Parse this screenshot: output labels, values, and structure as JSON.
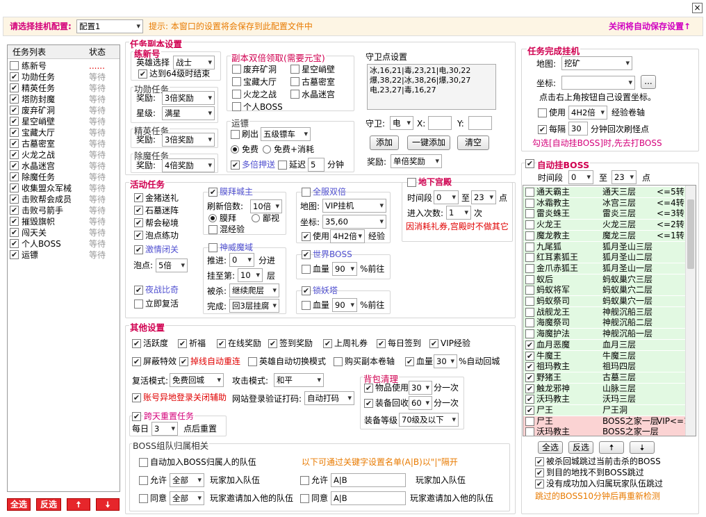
{
  "window": {
    "close": "×"
  },
  "header": {
    "select_label": "请选择挂机配置:",
    "config": "配置1",
    "hint": "提示: 本窗口的设置将会保存到此配置文件中",
    "close_hint": "关闭将自动保存设置↑"
  },
  "task_list": {
    "col1": "任务列表",
    "col2": "状态",
    "items": [
      {
        "name": "练新号",
        "checked": false,
        "status": "......"
      },
      {
        "name": "功勋任务",
        "checked": true,
        "status": "等待"
      },
      {
        "name": "精英任务",
        "checked": true,
        "status": "等待"
      },
      {
        "name": "塔防封魔",
        "checked": true,
        "status": "等待"
      },
      {
        "name": "废弃矿洞",
        "checked": true,
        "status": "等待"
      },
      {
        "name": "星空峭壁",
        "checked": true,
        "status": "等待"
      },
      {
        "name": "宝藏大厅",
        "checked": true,
        "status": "等待"
      },
      {
        "name": "古墓密室",
        "checked": true,
        "status": "等待"
      },
      {
        "name": "火龙之战",
        "checked": true,
        "status": "等待"
      },
      {
        "name": "水晶迷宫",
        "checked": true,
        "status": "等待"
      },
      {
        "name": "除魔任务",
        "checked": true,
        "status": "等待"
      },
      {
        "name": "收集盟众军械",
        "checked": true,
        "status": "等待"
      },
      {
        "name": "击败帮会成员",
        "checked": true,
        "status": "等待"
      },
      {
        "name": "击败弓箭手",
        "checked": true,
        "status": "等待"
      },
      {
        "name": "摧毁旗帜",
        "checked": true,
        "status": "等待"
      },
      {
        "name": "闯天关",
        "checked": true,
        "status": "等待"
      },
      {
        "name": "个人BOSS",
        "checked": true,
        "status": "等待"
      },
      {
        "name": "运镖",
        "checked": true,
        "status": "等待"
      }
    ],
    "buttons": {
      "all": "全选",
      "invert": "反选",
      "up": "🠅",
      "down": "🠇"
    }
  },
  "dungeon": {
    "title": "任务副本设置",
    "new": {
      "title": "练新号",
      "hero_label": "英雄选择",
      "hero": "战士",
      "stop_label": "达到64级时结束"
    },
    "merit": {
      "title": "功勋任务",
      "reward_label": "奖励:",
      "reward": "3倍奖励",
      "star_label": "星级:",
      "star": "满星"
    },
    "elite": {
      "title": "精英任务",
      "reward_label": "奖励:",
      "reward": "3倍奖励"
    },
    "demon": {
      "title": "除魔任务",
      "reward_label": "奖励:",
      "reward": "4倍奖励"
    },
    "double": {
      "title": "副本双倍领取(需要元宝)",
      "items": [
        "废弃矿洞",
        "星空峭壁",
        "宝藏大厅",
        "古墓密室",
        "火龙之战",
        "水晶迷宫",
        "个人BOSS"
      ]
    },
    "escort": {
      "title": "运镖",
      "refresh_label": "刷出",
      "refresh": "五级镖车",
      "free": "免费",
      "free_paid": "免费+消耗",
      "multi": "多倍押送",
      "delay": "延迟",
      "delay_val": "5",
      "min": "分钟"
    },
    "guard": {
      "title": "守卫点设置",
      "points": "冰,16,21|毒,23,21|电,30,22\n爆,38,22|冰,38,26|爆,30,27\n电,23,27|毒,16,27",
      "guard_label": "守卫:",
      "guard": "电",
      "x": "X:",
      "y": "Y:",
      "add": "添加",
      "add_all": "一键添加",
      "clear": "清空",
      "reward_label": "奖励:",
      "reward": "单倍奖励"
    }
  },
  "activity": {
    "title": "活动任务",
    "items": [
      "金猪送礼",
      "石墓迷阵",
      "帮会秘境",
      "泡点练功"
    ],
    "trial": "激情闭关",
    "points_label": "泡点:",
    "points": "5倍",
    "night": "夜战比奇",
    "revive": "立即复活",
    "worship": {
      "title": "膜拜城主",
      "refresh_label": "刷新倍数:",
      "refresh": "10倍",
      "worship": "膜拜",
      "despise": "鄙视",
      "mixed": "混经验"
    },
    "shenwei": {
      "title": "神威魔域",
      "push_label": "推进:",
      "push": "0",
      "push_unit": "分进",
      "hang_label": "挂至第:",
      "hang": "10",
      "floor": "层",
      "kill_label": "被杀:",
      "kill": "继续爬层",
      "done_label": "完成:",
      "done": "回3层挂腐"
    },
    "double_all": {
      "title": "全服双倍",
      "map_label": "地图:",
      "map": "VIP挂机",
      "coord_label": "坐标:",
      "coord": "35,60",
      "use": "使用",
      "use_item": "4H2倍",
      "exp": "经验"
    },
    "world_boss": {
      "title": "世界BOSS",
      "hp": "血量",
      "hp_val": "90",
      "go": "%前往"
    },
    "tower": {
      "title": "锁妖塔",
      "hp": "血量",
      "hp_val": "90",
      "go": "%前往"
    },
    "palace": {
      "title": "地下宫殿",
      "time_label": "时间段",
      "from": "0",
      "to_label": "至",
      "to": "23",
      "point": "点",
      "enter_label": "进入次数:",
      "enter": "1",
      "times": "次",
      "warn": "因消耗礼券,宫殿时不做其它"
    }
  },
  "other": {
    "title": "其他设置",
    "row1": [
      "活跃度",
      "祈福",
      "在线奖励",
      "签到奖励",
      "上周礼券",
      "每日签到",
      "VIP经验"
    ],
    "block_effects": "屏蔽特效",
    "reconnect": "掉线自动重连",
    "auto_mode": "英雄自动切换模式",
    "buy_scroll": "购买副本卷轴",
    "hp": "血量",
    "hp_val": "30",
    "hp_back": "%自动回城",
    "revive_label": "复活模式:",
    "revive": "免费回城",
    "attack_label": "攻击模式:",
    "attack": "和平",
    "remote_close": "账号异地登录关闭辅助",
    "verify_label": "网站登录验证打码:",
    "verify": "自动打码",
    "cross_day": "跨天重置任务",
    "daily_label": "每日",
    "daily": "3",
    "reset": "点后重置",
    "bag": {
      "title": "背包清理",
      "use": "物品使用",
      "use_val": "30",
      "use_unit": "分一次",
      "recycle": "装备回收",
      "recycle_val": "60",
      "recycle_unit": "分一次",
      "level_label": "装备等级",
      "level": "70级及以下"
    },
    "boss_team": {
      "title": "BOSS组队归属相关",
      "auto_join": "自动加入BOSS归属人的队伍",
      "note": "以下可通过关键字设置名单(A|B)以\"|\"隔开",
      "allow1": "允许",
      "all1": "全部",
      "join_team": "玩家加入队伍",
      "allow2": "允许",
      "ab1": "A|B",
      "join_team2": "玩家加入队伍",
      "agree1": "同意",
      "all2": "全部",
      "invite": "玩家邀请加入他的队伍",
      "agree2": "同意",
      "ab2": "A|B",
      "invite2": "玩家邀请加入他的队伍"
    }
  },
  "finish": {
    "title": "任务完成挂机",
    "map_label": "地图:",
    "map": "挖矿",
    "coord_label": "坐标:",
    "coord": "",
    "more": "...",
    "hint": "点击右上角按钮自己设置坐标。",
    "use": "使用",
    "use_item": "4H2倍",
    "exp_scroll": "经验卷轴",
    "interval": "每隔",
    "interval_val": "30",
    "interval_unit": "分钟回次刷怪点",
    "warn": "勾选[自动挂BOSS]时,先去打BOSS"
  },
  "auto_boss": {
    "title": "自动挂BOSS",
    "time_label": "时间段",
    "from": "0",
    "to_label": "至",
    "to": "23",
    "point": "点",
    "list": [
      {
        "name": "通天霸主",
        "loc": "通天三层",
        "req": "<=5转",
        "checked": false,
        "hl": "g"
      },
      {
        "name": "冰霜教主",
        "loc": "冰宫三层",
        "req": "<=4转",
        "checked": false,
        "hl": "g"
      },
      {
        "name": "雷炎蛛王",
        "loc": "雷炎三层",
        "req": "<=3转",
        "checked": false,
        "hl": "g"
      },
      {
        "name": "火龙王",
        "loc": "火龙三层",
        "req": "<=2转",
        "checked": false,
        "hl": "g"
      },
      {
        "name": "魔龙教主",
        "loc": "魔龙三层",
        "req": "<=1转",
        "checked": false,
        "hl": "g"
      },
      {
        "name": "九尾狐",
        "loc": "狐月圣山三层",
        "req": "",
        "checked": false,
        "hl": "g"
      },
      {
        "name": "红耳素狐王",
        "loc": "狐月圣山二层",
        "req": "",
        "checked": false,
        "hl": "g"
      },
      {
        "name": "金爪赤狐王",
        "loc": "狐月圣山一层",
        "req": "",
        "checked": false,
        "hl": "g"
      },
      {
        "name": "蚁后",
        "loc": "蚂蚁巢穴三层",
        "req": "",
        "checked": false,
        "hl": "g"
      },
      {
        "name": "蚂蚁将军",
        "loc": "蚂蚁巢穴二层",
        "req": "",
        "checked": false,
        "hl": "g"
      },
      {
        "name": "蚂蚁祭司",
        "loc": "蚂蚁巢穴一层",
        "req": "",
        "checked": false,
        "hl": "g"
      },
      {
        "name": "战舰龙王",
        "loc": "神舰沉船三层",
        "req": "",
        "checked": false,
        "hl": "g"
      },
      {
        "name": "海魔祭司",
        "loc": "神舰沉船二层",
        "req": "",
        "checked": false,
        "hl": "g"
      },
      {
        "name": "海魔护法",
        "loc": "神舰沉船一层",
        "req": "",
        "checked": false,
        "hl": "g"
      },
      {
        "name": "血月恶魔",
        "loc": "血月三层",
        "req": "",
        "checked": true,
        "hl": "g"
      },
      {
        "name": "牛魔王",
        "loc": "牛魔三层",
        "req": "",
        "checked": true,
        "hl": "g"
      },
      {
        "name": "祖玛教主",
        "loc": "祖玛四层",
        "req": "",
        "checked": true,
        "hl": "g"
      },
      {
        "name": "野猪王",
        "loc": "古墓三层",
        "req": "",
        "checked": true,
        "hl": "g"
      },
      {
        "name": "触龙邪神",
        "loc": "山脉三层",
        "req": "",
        "checked": true,
        "hl": "g"
      },
      {
        "name": "沃玛教主",
        "loc": "沃玛三层",
        "req": "",
        "checked": true,
        "hl": "g"
      },
      {
        "name": "尸王",
        "loc": "尸王洞",
        "req": "",
        "checked": true,
        "hl": "g"
      },
      {
        "name": "尸王",
        "loc": "BOSS之家一层",
        "req": "VIP<=1",
        "checked": false,
        "hl": "p"
      },
      {
        "name": "沃玛教主",
        "loc": "BOSS之家一层",
        "req": "",
        "checked": false,
        "hl": "p"
      }
    ],
    "all": "全选",
    "invert": "反选",
    "up": "🠅",
    "down": "🠇",
    "opt1": "被杀回城跳过当前击杀的BOSS",
    "opt2": "到目的地找不到BOSS跳过",
    "opt3": "没有成功加入归属玩家队伍跳过",
    "note": "跳过的BOSS10分钟后再重新检测"
  }
}
